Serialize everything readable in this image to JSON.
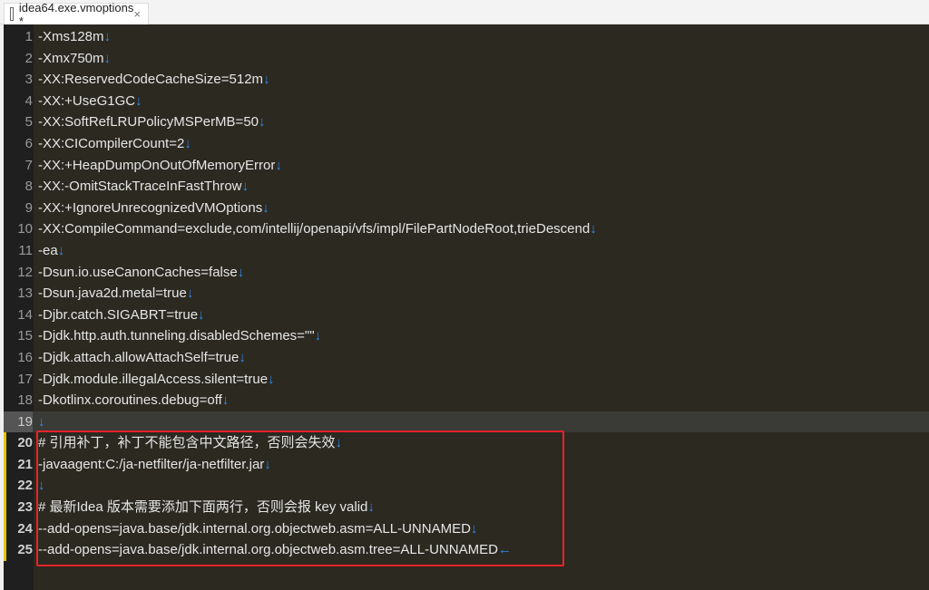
{
  "tab": {
    "title": "idea64.exe.vmoptions *",
    "close": "×"
  },
  "eol_marker": "↓",
  "last_eol_marker": "←",
  "current_line": 19,
  "lines": [
    {
      "n": "1",
      "text": "-Xms128m"
    },
    {
      "n": "2",
      "text": "-Xmx750m"
    },
    {
      "n": "3",
      "text": "-XX:ReservedCodeCacheSize=512m"
    },
    {
      "n": "4",
      "text": "-XX:+UseG1GC"
    },
    {
      "n": "5",
      "text": "-XX:SoftRefLRUPolicyMSPerMB=50"
    },
    {
      "n": "6",
      "text": "-XX:CICompilerCount=2"
    },
    {
      "n": "7",
      "text": "-XX:+HeapDumpOnOutOfMemoryError"
    },
    {
      "n": "8",
      "text": "-XX:-OmitStackTraceInFastThrow"
    },
    {
      "n": "9",
      "text": "-XX:+IgnoreUnrecognizedVMOptions"
    },
    {
      "n": "10",
      "text": "-XX:CompileCommand=exclude,com/intellij/openapi/vfs/impl/FilePartNodeRoot,trieDescend"
    },
    {
      "n": "11",
      "text": "-ea"
    },
    {
      "n": "12",
      "text": "-Dsun.io.useCanonCaches=false"
    },
    {
      "n": "13",
      "text": "-Dsun.java2d.metal=true"
    },
    {
      "n": "14",
      "text": "-Djbr.catch.SIGABRT=true"
    },
    {
      "n": "15",
      "text": "-Djdk.http.auth.tunneling.disabledSchemes=\"\""
    },
    {
      "n": "16",
      "text": "-Djdk.attach.allowAttachSelf=true"
    },
    {
      "n": "17",
      "text": "-Djdk.module.illegalAccess.silent=true"
    },
    {
      "n": "18",
      "text": "-Dkotlinx.coroutines.debug=off"
    },
    {
      "n": "19",
      "text": ""
    },
    {
      "n": "20",
      "text": "# 引用补丁，补丁不能包含中文路径，否则会失效"
    },
    {
      "n": "21",
      "text": "-javaagent:C:/ja-netfilter/ja-netfilter.jar"
    },
    {
      "n": "22",
      "text": ""
    },
    {
      "n": "23",
      "text": "# 最新Idea 版本需要添加下面两行，否则会报 key valid"
    },
    {
      "n": "24",
      "text": "--add-opens=java.base/jdk.internal.org.objectweb.asm=ALL-UNNAMED"
    },
    {
      "n": "25",
      "text": "--add-opens=java.base/jdk.internal.org.objectweb.asm.tree=ALL-UNNAMED"
    }
  ]
}
